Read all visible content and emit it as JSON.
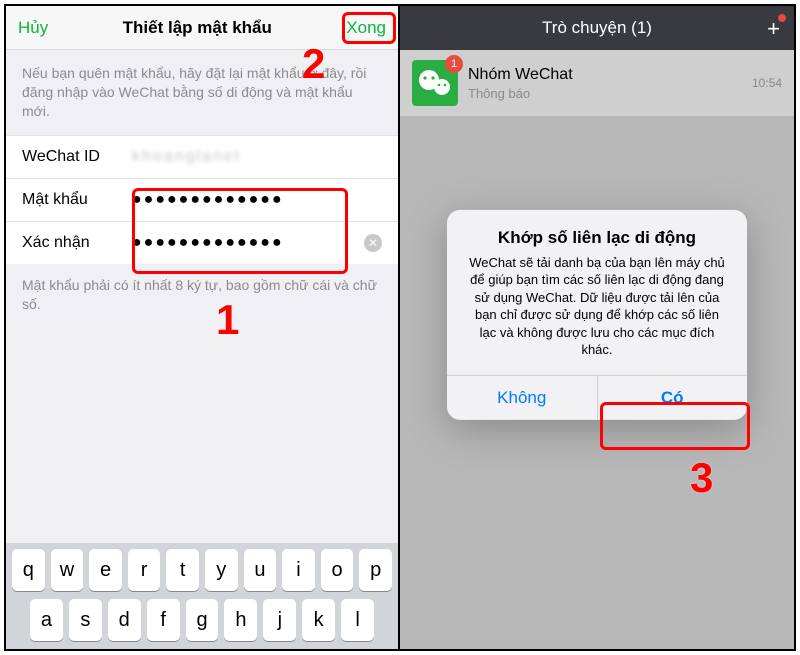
{
  "left": {
    "nav": {
      "cancel": "Hủy",
      "title": "Thiết lập mật khẩu",
      "done": "Xong"
    },
    "info": "Nếu bạn quên mật khẩu, hãy đặt lại mật khẩu ở đây, rồi đăng nhập vào WeChat bằng số di động và mật khẩu mới.",
    "fields": {
      "wechat_id_label": "WeChat ID",
      "wechat_id_value": "khoanglanet",
      "password_label": "Mật khẩu",
      "password_value": "●●●●●●●●●●●●●",
      "confirm_label": "Xác nhận",
      "confirm_value": "●●●●●●●●●●●●●"
    },
    "hint": "Mật khẩu phải có ít nhất 8 ký tự, bao gồm chữ cái và chữ số.",
    "keyboard": {
      "row1": [
        "q",
        "w",
        "e",
        "r",
        "t",
        "y",
        "u",
        "i",
        "o",
        "p"
      ],
      "row2": [
        "a",
        "s",
        "d",
        "f",
        "g",
        "h",
        "j",
        "k",
        "l"
      ]
    }
  },
  "right": {
    "nav": {
      "title": "Trò chuyện (1)"
    },
    "chat": {
      "name": "Nhóm WeChat",
      "sub": "Thông báo",
      "time": "10:54",
      "badge": "1"
    },
    "alert": {
      "title": "Khớp số liên lạc di động",
      "message": "WeChat sẽ tải danh bạ của bạn lên máy chủ để giúp bạn tìm các số liên lạc di động đang sử dụng WeChat. Dữ liệu được tải lên của bạn chỉ được sử dụng để khớp các số liên lạc và không được lưu cho các mục đích khác.",
      "no": "Không",
      "yes": "Có"
    }
  },
  "annotations": {
    "n1": "1",
    "n2": "2",
    "n3": "3"
  }
}
